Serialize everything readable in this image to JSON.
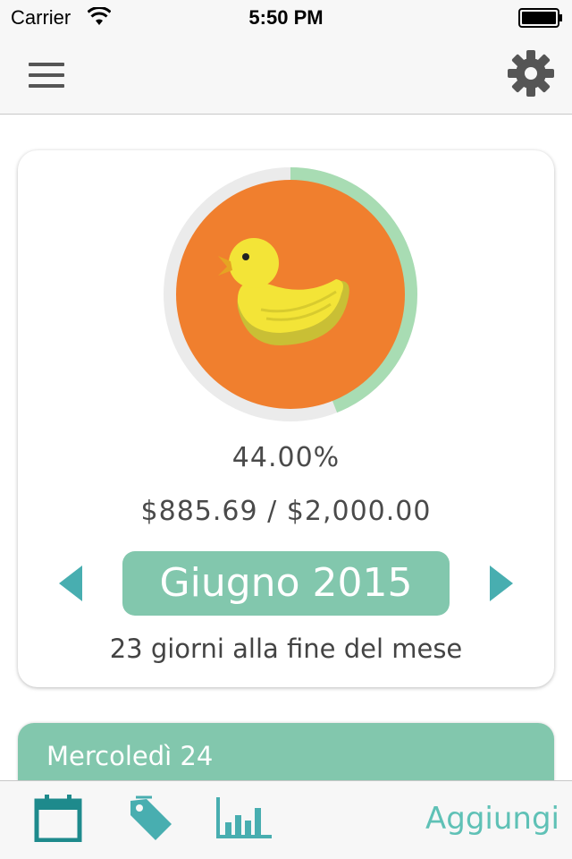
{
  "status_bar": {
    "carrier": "Carrier",
    "time": "5:50 PM",
    "icons": [
      "wifi-icon",
      "battery-icon"
    ]
  },
  "nav": {
    "icons": [
      "menu-icon",
      "gear-icon"
    ]
  },
  "budget": {
    "illustration": "duck-icon",
    "progress_fraction": 0.44,
    "percent_label": "44.00%",
    "amounts_label": "$885.69 / $2,000.00",
    "month_label": "Giugno 2015",
    "days_left_label": "23 giorni alla fine del mese"
  },
  "day": {
    "label": "Mercoledì 24"
  },
  "tab_bar": {
    "icons": [
      "calendar-icon",
      "tag-icon",
      "bar-chart-icon"
    ],
    "add_label": "Aggiungi"
  },
  "colors": {
    "accent": "#82c7ad",
    "ring_progress": "#a8dcb3",
    "ring_track": "#ebebeb",
    "circle_fill": "#f07f2e",
    "arrows": "#48aeb0",
    "tab_icons": "#1e8a8c",
    "add_text": "#5fc1b6"
  }
}
